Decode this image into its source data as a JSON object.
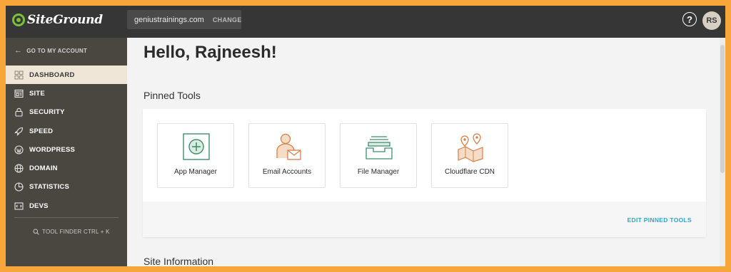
{
  "topbar": {
    "logo_text": "SiteGround",
    "domain": "geniustrainings.com",
    "change_label": "CHANGE",
    "help_symbol": "?",
    "avatar_initials": "RS"
  },
  "sidebar": {
    "back_label": "GO TO MY ACCOUNT",
    "items": [
      {
        "label": "DASHBOARD",
        "icon": "dashboard-icon"
      },
      {
        "label": "SITE",
        "icon": "site-icon"
      },
      {
        "label": "SECURITY",
        "icon": "lock-icon"
      },
      {
        "label": "SPEED",
        "icon": "rocket-icon"
      },
      {
        "label": "WORDPRESS",
        "icon": "wordpress-icon"
      },
      {
        "label": "DOMAIN",
        "icon": "globe-icon"
      },
      {
        "label": "STATISTICS",
        "icon": "pie-chart-icon"
      },
      {
        "label": "DEVS",
        "icon": "code-icon"
      }
    ],
    "tool_finder_label": "TOOL FINDER CTRL + K"
  },
  "main": {
    "greeting": "Hello, Rajneesh!",
    "pinned_title": "Pinned Tools",
    "pinned_tools": [
      {
        "label": "App Manager",
        "icon": "app-manager-icon"
      },
      {
        "label": "Email Accounts",
        "icon": "email-accounts-icon"
      },
      {
        "label": "File Manager",
        "icon": "file-manager-icon"
      },
      {
        "label": "Cloudflare CDN",
        "icon": "cloudflare-cdn-icon"
      }
    ],
    "edit_pinned_label": "EDIT PINNED TOOLS",
    "site_info_title": "Site Information"
  },
  "colors": {
    "border_orange": "#f7a63a",
    "topbar": "#363636",
    "sidebar": "#4a4741",
    "active_item": "#efe6d8",
    "accent_blue": "#2fa6c7",
    "icon_green": "#3f8f6b",
    "icon_orange": "#d9804a"
  }
}
